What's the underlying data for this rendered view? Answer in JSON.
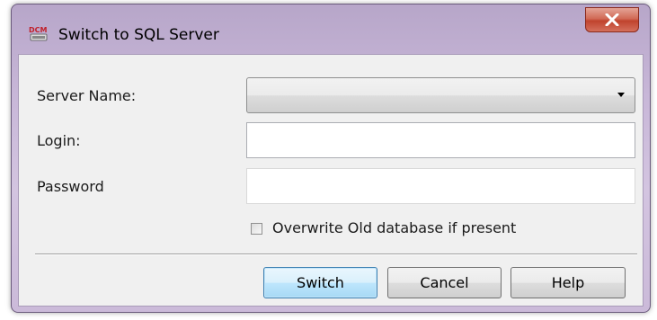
{
  "window": {
    "title": "Switch to SQL Server",
    "icon": "dcm-app-icon",
    "icon_text_top": "DCM",
    "close_icon": "close-x-icon"
  },
  "form": {
    "server_name_label": "Server Name:",
    "server_name_value": "",
    "login_label": "Login:",
    "login_value": "",
    "password_label": "Password",
    "password_value": "",
    "overwrite_label": "Overwrite Old database if present",
    "overwrite_checked": false
  },
  "buttons": {
    "switch_label": "Switch",
    "cancel_label": "Cancel",
    "help_label": "Help"
  },
  "colors": {
    "titlebar": "#c8b7d8",
    "close_button": "#c0432d",
    "default_button": "#bee6fd",
    "client_bg": "#f0f0f0"
  }
}
